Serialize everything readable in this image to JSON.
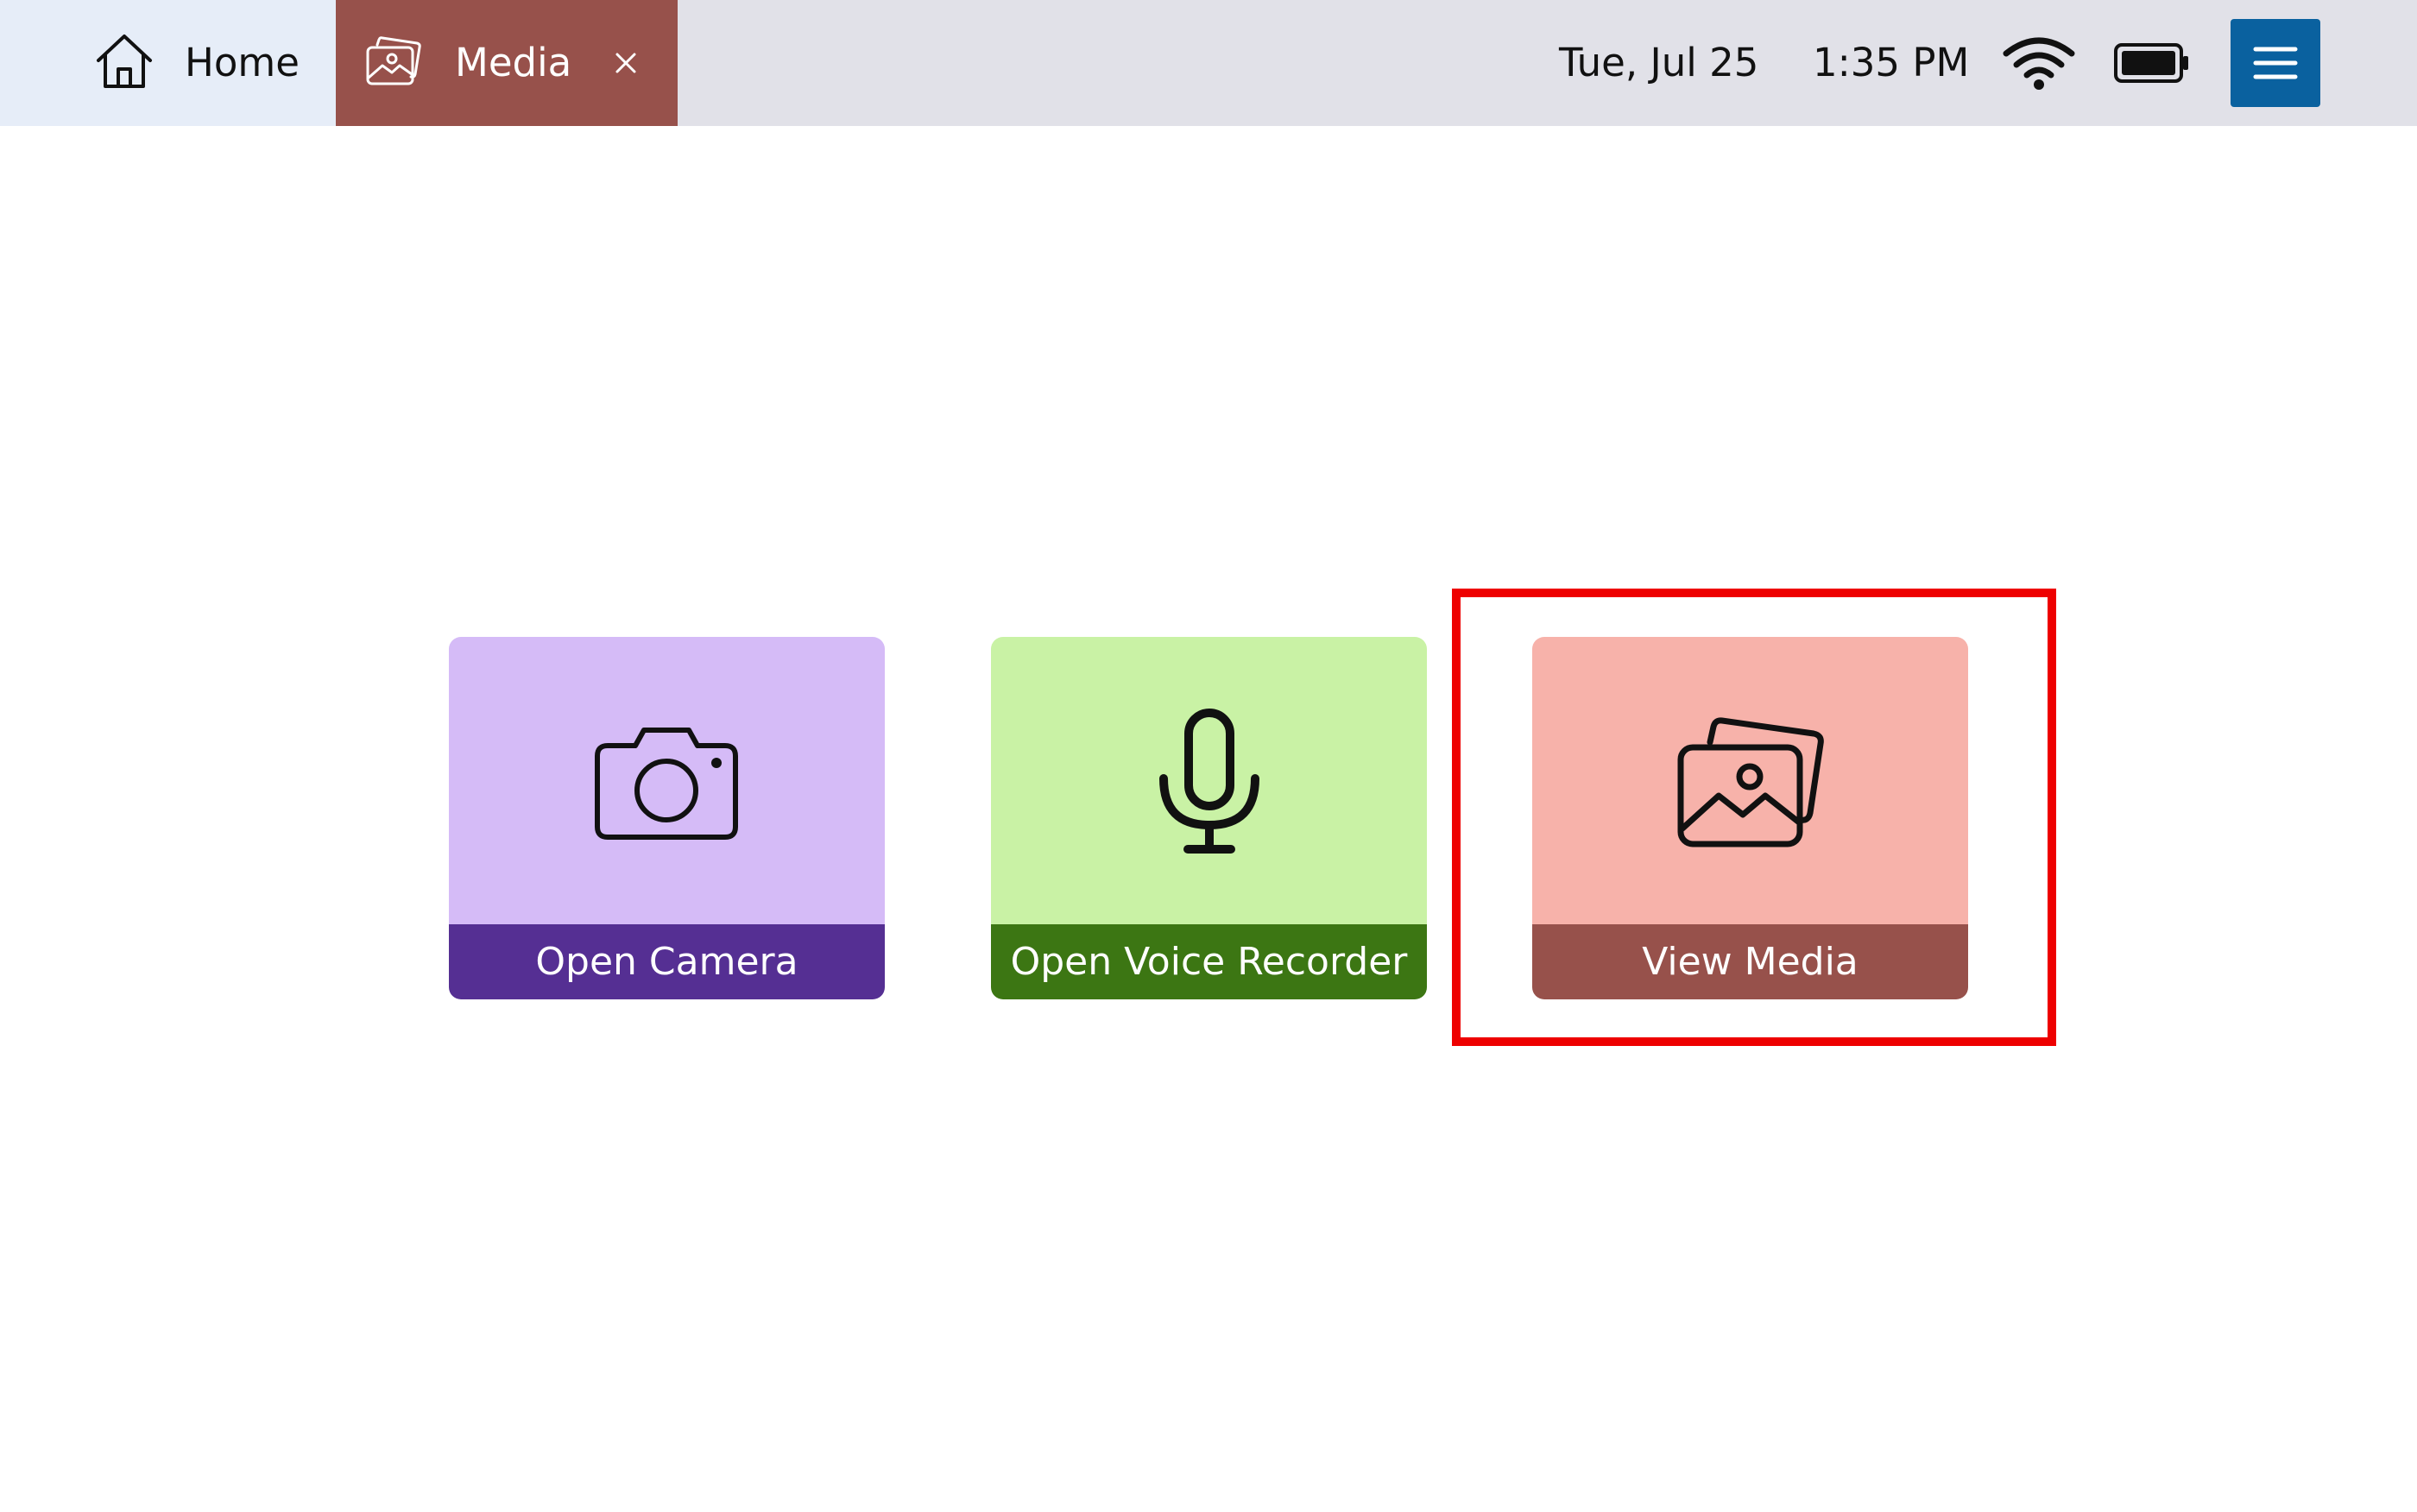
{
  "topbar": {
    "tabs": [
      {
        "label": "Home",
        "icon": "home-icon",
        "active": false
      },
      {
        "label": "Media",
        "icon": "images-icon",
        "active": true,
        "closable": true
      }
    ],
    "status": {
      "date": "Tue, Jul 25",
      "time": "1:35 PM",
      "wifi_icon": "wifi-icon",
      "battery_icon": "battery-full-icon"
    },
    "menu_icon": "hamburger-menu-icon"
  },
  "actions": [
    {
      "label": "Open Camera",
      "icon": "camera-icon",
      "color_top": "#d5bbf7",
      "color_bottom": "#552f93"
    },
    {
      "label": "Open Voice Recorder",
      "icon": "microphone-icon",
      "color_top": "#c9f2a5",
      "color_bottom": "#3c7613"
    },
    {
      "label": "View Media",
      "icon": "images-icon",
      "color_top": "#f7b2aa",
      "color_bottom": "#97514b",
      "highlighted": true
    }
  ],
  "colors": {
    "topbar_bg": "#e1e1e8",
    "home_tab_bg": "#e6edf8",
    "media_tab_bg": "#97514b",
    "menu_button_bg": "#0a619f",
    "highlight": "#ee0000"
  }
}
